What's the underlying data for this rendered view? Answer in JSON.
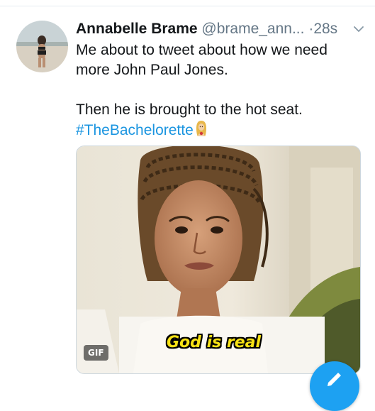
{
  "tweet": {
    "display_name": "Annabelle Brame",
    "handle": "@brame_ann...",
    "separator": "·",
    "timestamp": "28s",
    "lines": [
      "Me about to tweet about how we need",
      "more John Paul Jones.",
      "Then he is brought to the hot seat."
    ],
    "hashtag": "#TheBachelorette",
    "hashtag_emoji": "rose-woman-emoji",
    "media": {
      "caption": "God is real",
      "badge": "GIF"
    }
  },
  "icons": {
    "chevron": "chevron-down-icon",
    "compose": "compose-icon"
  },
  "colors": {
    "link": "#1b95e0",
    "fab": "#1da1f2",
    "secondary_text": "#657786",
    "caption": "#f7e214"
  }
}
